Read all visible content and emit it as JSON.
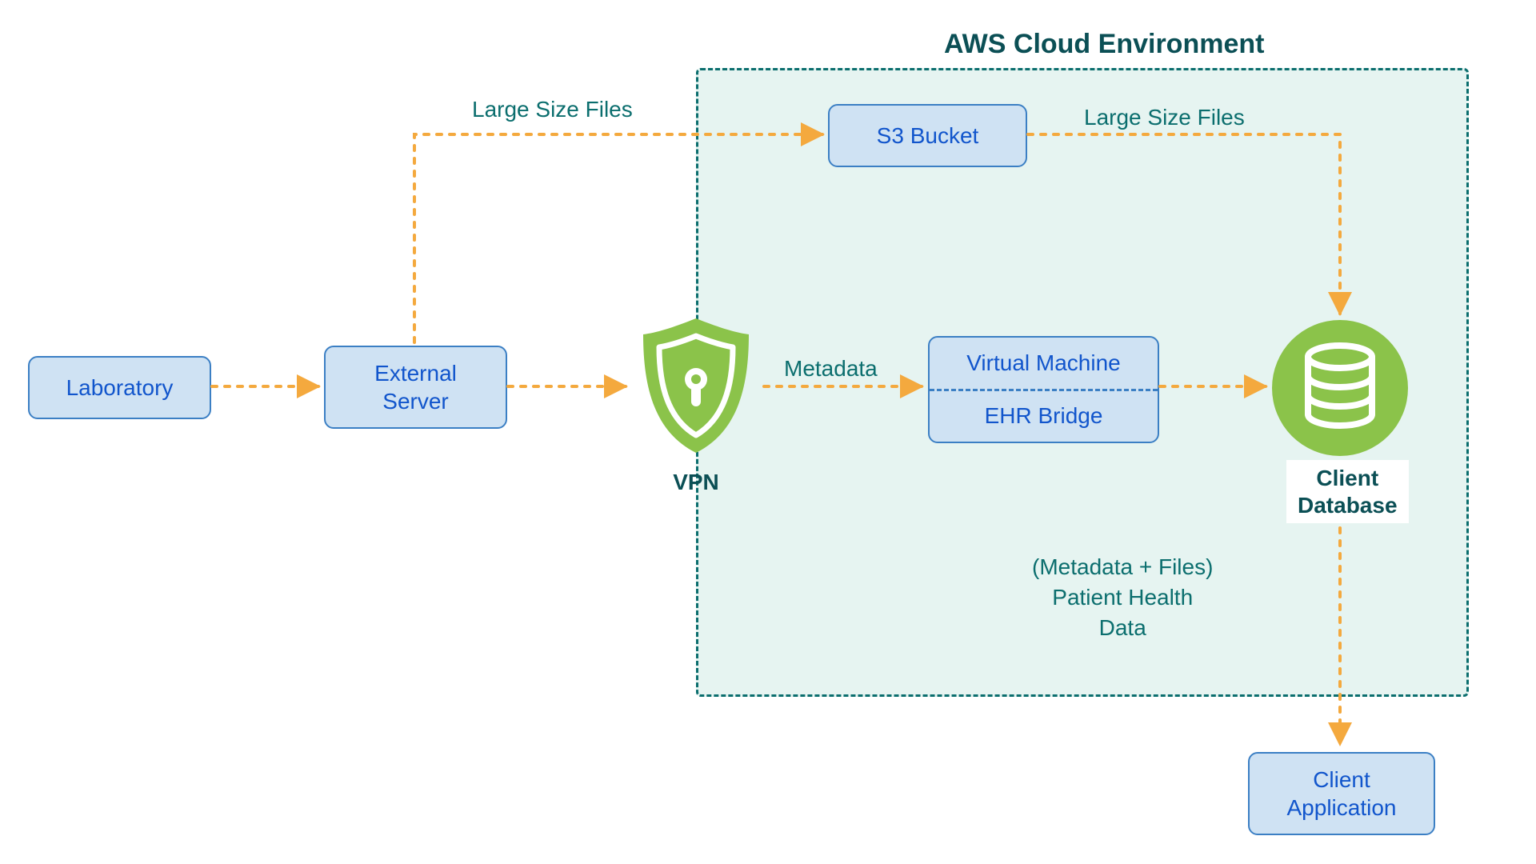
{
  "cloud": {
    "title": "AWS Cloud Environment"
  },
  "nodes": {
    "laboratory": "Laboratory",
    "external_server": "External\nServer",
    "vpn": "VPN",
    "s3": "S3 Bucket",
    "vm_top": "Virtual Machine",
    "vm_bottom": "EHR Bridge",
    "client_db": "Client\nDatabase",
    "client_app": "Client\nApplication"
  },
  "edges": {
    "large_files_1": "Large Size Files",
    "metadata": "Metadata",
    "large_files_2": "Large Size Files",
    "phd": "(Metadata + Files)\nPatient Health\nData"
  },
  "colors": {
    "node_fill": "#cfe2f3",
    "node_border": "#3b7fc4",
    "node_text": "#1155cc",
    "cloud_border": "#0b6e6e",
    "cloud_fill": "rgba(210,235,230,0.55)",
    "arrow": "#f4a93e",
    "accent_green": "#8bc34a",
    "label_text": "#0b6e6e"
  }
}
